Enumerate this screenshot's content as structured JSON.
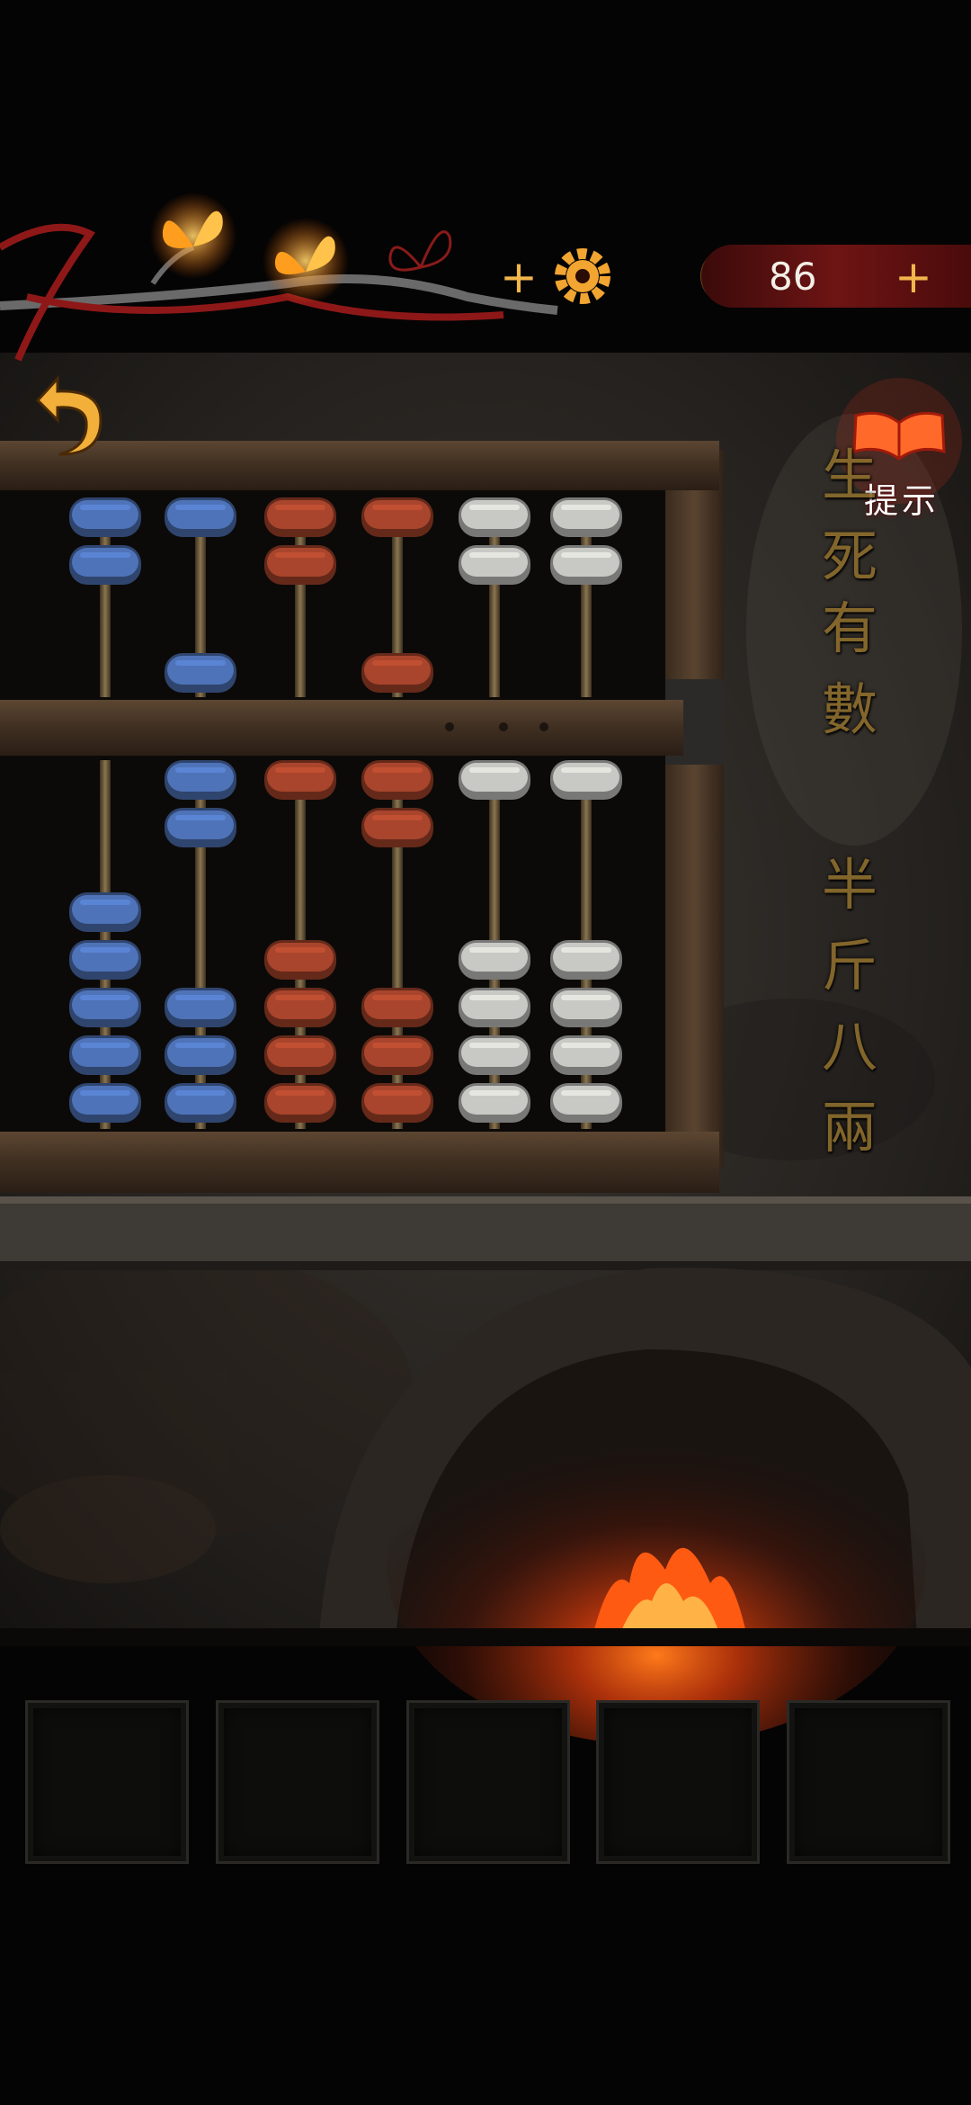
{
  "hud": {
    "butterflies": [
      {
        "name": "butterfly-lit",
        "state": "lit"
      },
      {
        "name": "butterfly-lit",
        "state": "lit"
      },
      {
        "name": "butterfly-outline",
        "state": "empty"
      }
    ],
    "add_life_label": "+",
    "settings_icon": "gear-icon",
    "coins": {
      "icon": "copper-coin-icon",
      "count": "86",
      "add_label": "+"
    }
  },
  "back_button": {
    "icon": "back-arrow-icon"
  },
  "hint_button": {
    "icon": "open-book-icon",
    "label": "提示"
  },
  "abacus": {
    "rods": [
      {
        "color": "#4f73b8",
        "upper_beads_up": 2,
        "upper_beads_down": 0,
        "lower_beads_up": 0,
        "lower_beads_down": 5
      },
      {
        "color": "#4f73b8",
        "upper_beads_up": 1,
        "upper_beads_down": 1,
        "lower_beads_up": 2,
        "lower_beads_down": 3
      },
      {
        "color": "#a8452c",
        "upper_beads_up": 2,
        "upper_beads_down": 0,
        "lower_beads_up": 1,
        "lower_beads_down": 4
      },
      {
        "color": "#a8452c",
        "upper_beads_up": 1,
        "upper_beads_down": 1,
        "lower_beads_up": 2,
        "lower_beads_down": 3
      },
      {
        "color": "#c8c8c4",
        "upper_beads_up": 2,
        "upper_beads_down": 0,
        "lower_beads_up": 1,
        "lower_beads_down": 4
      },
      {
        "color": "#c8c8c4",
        "upper_beads_up": 2,
        "upper_beads_down": 0,
        "lower_beads_up": 1,
        "lower_beads_down": 4
      }
    ]
  },
  "wall_inscription": {
    "line1": [
      "生",
      "死",
      "有",
      "數"
    ],
    "line2": [
      "半",
      "斤",
      "八",
      "兩"
    ]
  },
  "inventory": {
    "slots": [
      {
        "item": "needle-icon"
      },
      {
        "item": "gourd-icon"
      },
      {
        "item": ""
      },
      {
        "item": ""
      },
      {
        "item": ""
      }
    ]
  },
  "colors": {
    "accent_gold": "#f2b64c",
    "coin_bar": "#6e1414",
    "hint_red": "#e03a1a"
  }
}
